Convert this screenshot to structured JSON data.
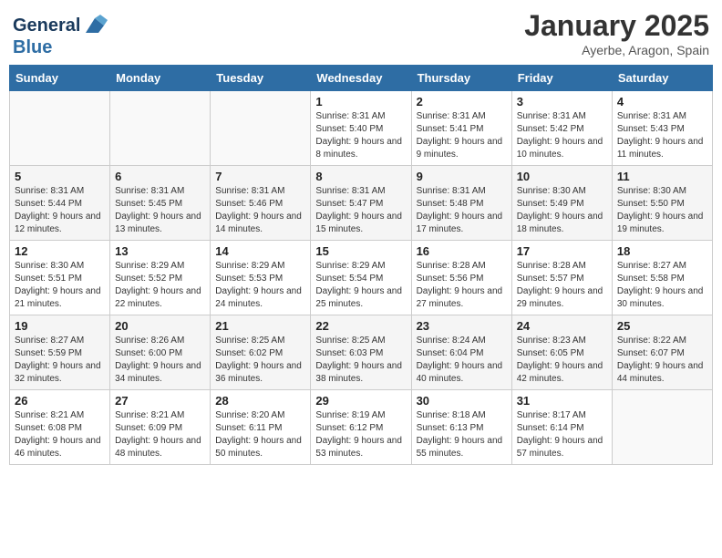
{
  "logo": {
    "line1": "General",
    "line2": "Blue"
  },
  "title": "January 2025",
  "location": "Ayerbe, Aragon, Spain",
  "days_of_week": [
    "Sunday",
    "Monday",
    "Tuesday",
    "Wednesday",
    "Thursday",
    "Friday",
    "Saturday"
  ],
  "weeks": [
    [
      {
        "day": "",
        "info": ""
      },
      {
        "day": "",
        "info": ""
      },
      {
        "day": "",
        "info": ""
      },
      {
        "day": "1",
        "info": "Sunrise: 8:31 AM\nSunset: 5:40 PM\nDaylight: 9 hours and 8 minutes."
      },
      {
        "day": "2",
        "info": "Sunrise: 8:31 AM\nSunset: 5:41 PM\nDaylight: 9 hours and 9 minutes."
      },
      {
        "day": "3",
        "info": "Sunrise: 8:31 AM\nSunset: 5:42 PM\nDaylight: 9 hours and 10 minutes."
      },
      {
        "day": "4",
        "info": "Sunrise: 8:31 AM\nSunset: 5:43 PM\nDaylight: 9 hours and 11 minutes."
      }
    ],
    [
      {
        "day": "5",
        "info": "Sunrise: 8:31 AM\nSunset: 5:44 PM\nDaylight: 9 hours and 12 minutes."
      },
      {
        "day": "6",
        "info": "Sunrise: 8:31 AM\nSunset: 5:45 PM\nDaylight: 9 hours and 13 minutes."
      },
      {
        "day": "7",
        "info": "Sunrise: 8:31 AM\nSunset: 5:46 PM\nDaylight: 9 hours and 14 minutes."
      },
      {
        "day": "8",
        "info": "Sunrise: 8:31 AM\nSunset: 5:47 PM\nDaylight: 9 hours and 15 minutes."
      },
      {
        "day": "9",
        "info": "Sunrise: 8:31 AM\nSunset: 5:48 PM\nDaylight: 9 hours and 17 minutes."
      },
      {
        "day": "10",
        "info": "Sunrise: 8:30 AM\nSunset: 5:49 PM\nDaylight: 9 hours and 18 minutes."
      },
      {
        "day": "11",
        "info": "Sunrise: 8:30 AM\nSunset: 5:50 PM\nDaylight: 9 hours and 19 minutes."
      }
    ],
    [
      {
        "day": "12",
        "info": "Sunrise: 8:30 AM\nSunset: 5:51 PM\nDaylight: 9 hours and 21 minutes."
      },
      {
        "day": "13",
        "info": "Sunrise: 8:29 AM\nSunset: 5:52 PM\nDaylight: 9 hours and 22 minutes."
      },
      {
        "day": "14",
        "info": "Sunrise: 8:29 AM\nSunset: 5:53 PM\nDaylight: 9 hours and 24 minutes."
      },
      {
        "day": "15",
        "info": "Sunrise: 8:29 AM\nSunset: 5:54 PM\nDaylight: 9 hours and 25 minutes."
      },
      {
        "day": "16",
        "info": "Sunrise: 8:28 AM\nSunset: 5:56 PM\nDaylight: 9 hours and 27 minutes."
      },
      {
        "day": "17",
        "info": "Sunrise: 8:28 AM\nSunset: 5:57 PM\nDaylight: 9 hours and 29 minutes."
      },
      {
        "day": "18",
        "info": "Sunrise: 8:27 AM\nSunset: 5:58 PM\nDaylight: 9 hours and 30 minutes."
      }
    ],
    [
      {
        "day": "19",
        "info": "Sunrise: 8:27 AM\nSunset: 5:59 PM\nDaylight: 9 hours and 32 minutes."
      },
      {
        "day": "20",
        "info": "Sunrise: 8:26 AM\nSunset: 6:00 PM\nDaylight: 9 hours and 34 minutes."
      },
      {
        "day": "21",
        "info": "Sunrise: 8:25 AM\nSunset: 6:02 PM\nDaylight: 9 hours and 36 minutes."
      },
      {
        "day": "22",
        "info": "Sunrise: 8:25 AM\nSunset: 6:03 PM\nDaylight: 9 hours and 38 minutes."
      },
      {
        "day": "23",
        "info": "Sunrise: 8:24 AM\nSunset: 6:04 PM\nDaylight: 9 hours and 40 minutes."
      },
      {
        "day": "24",
        "info": "Sunrise: 8:23 AM\nSunset: 6:05 PM\nDaylight: 9 hours and 42 minutes."
      },
      {
        "day": "25",
        "info": "Sunrise: 8:22 AM\nSunset: 6:07 PM\nDaylight: 9 hours and 44 minutes."
      }
    ],
    [
      {
        "day": "26",
        "info": "Sunrise: 8:21 AM\nSunset: 6:08 PM\nDaylight: 9 hours and 46 minutes."
      },
      {
        "day": "27",
        "info": "Sunrise: 8:21 AM\nSunset: 6:09 PM\nDaylight: 9 hours and 48 minutes."
      },
      {
        "day": "28",
        "info": "Sunrise: 8:20 AM\nSunset: 6:11 PM\nDaylight: 9 hours and 50 minutes."
      },
      {
        "day": "29",
        "info": "Sunrise: 8:19 AM\nSunset: 6:12 PM\nDaylight: 9 hours and 53 minutes."
      },
      {
        "day": "30",
        "info": "Sunrise: 8:18 AM\nSunset: 6:13 PM\nDaylight: 9 hours and 55 minutes."
      },
      {
        "day": "31",
        "info": "Sunrise: 8:17 AM\nSunset: 6:14 PM\nDaylight: 9 hours and 57 minutes."
      },
      {
        "day": "",
        "info": ""
      }
    ]
  ]
}
